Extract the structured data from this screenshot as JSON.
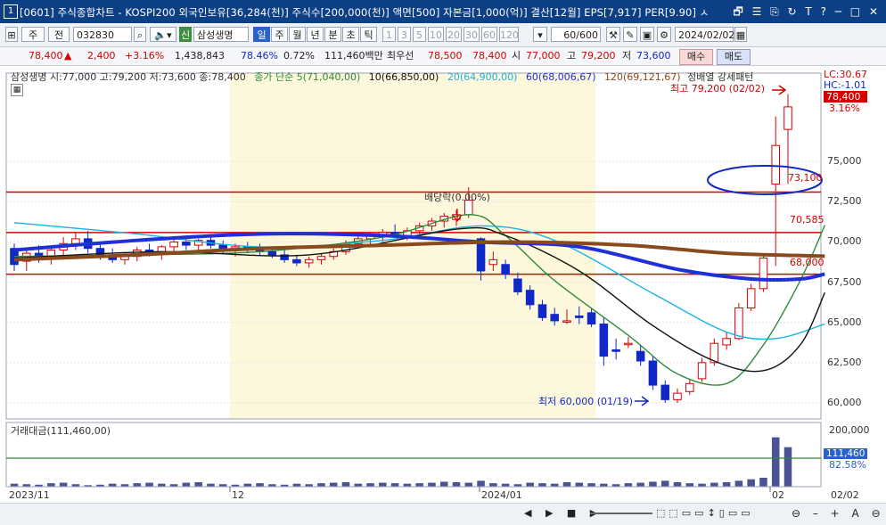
{
  "window": {
    "num": "1",
    "title": "[0601] 주식종합차트 - KOSPI200 외국인보유[36,284(천)] 주식수[200,000(천)] 액면[500] 자본금[1,000(억)] 결산[12월] EPS[7,917] PER[9.90] ㅅ",
    "icons": "🗗 ☰ ⎘ ↻ T ? ─ □ ✕"
  },
  "toolbar": {
    "market": "주",
    "period_btn": "전",
    "code": "032830",
    "badge": "신",
    "name": "삼성생명",
    "periods": [
      "일",
      "주",
      "월",
      "년",
      "분",
      "초",
      "틱"
    ],
    "minutes": [
      "1",
      "3",
      "5",
      "10",
      "20",
      "30",
      "60",
      "120"
    ],
    "count": "60",
    "total": "/600",
    "date": "2024/02/02",
    "buy": "매수",
    "sell": "매도"
  },
  "quote": {
    "price": "78,400",
    "arrow": "▲",
    "change": "2,400",
    "pct": "+3.16%",
    "volume": "1,438,843",
    "vol_ratio": "78.46%",
    "turnover": "0.72%",
    "amount": "111,460백만",
    "pref_label": "최우선",
    "ask": "78,500",
    "bid": "78,400",
    "open_label": "시",
    "open": "77,000",
    "high_label": "고",
    "high": "79,200",
    "low_label": "저",
    "low": "73,600"
  },
  "price_panel": {
    "legend_name": "삼성생명 시:77,000 고:79,200 저:73,600 종:78,400",
    "ma_label": "종가 단순 5(71,040,00)",
    "ma10": "10(66,850,00)",
    "ma20": "20(64,900,00)",
    "ma60": "60(68,006,67)",
    "ma120": "120(69,121,67)",
    "pattern": "정배열 강세패턴",
    "lc": "LC:30.67",
    "hc": "HC:-1.01",
    "last_price": "78,400",
    "last_pct": "3.16%",
    "high_note": "최고 79,200 (02/02)",
    "low_note": "최저 60,000 (01/19)",
    "dividend_note": "배당락(0.00%)",
    "level_73100": "73,100",
    "level_70585": "70,585",
    "level_68000": "68,000",
    "y_ticks": [
      "75,000",
      "72,500",
      "70,000",
      "67,500",
      "65,000",
      "62,500",
      "60,000"
    ]
  },
  "volume_panel": {
    "label": "거래대금(111,460,00)",
    "tick_top": "200,000",
    "current": "111,460",
    "current_pct": "82.58%"
  },
  "x_axis": {
    "labels": [
      "2023/11",
      "12",
      "2024/01",
      "02"
    ],
    "corner": "02/02"
  },
  "status": {
    "buttons": "◀ ▶ ■ ▶"
  },
  "colors": {
    "title_bg": "#0d3f84",
    "up": "#d60000",
    "down": "#1028c8",
    "ma5": "#2e8b3a",
    "ma10": "#111111",
    "ma20": "#19b3e6",
    "ma60": "#2030d8",
    "ma120": "#8a4a1e",
    "highlight": "#fdf8dc"
  },
  "chart_data": {
    "type": "candlestick",
    "title": "삼성생명",
    "ylim": [
      59000,
      80500
    ],
    "candles": [
      {
        "o": 69600,
        "h": 69900,
        "l": 68200,
        "c": 68600
      },
      {
        "o": 68800,
        "h": 69500,
        "l": 68200,
        "c": 69300
      },
      {
        "o": 69300,
        "h": 69800,
        "l": 68700,
        "c": 69100
      },
      {
        "o": 69100,
        "h": 69700,
        "l": 68600,
        "c": 69500
      },
      {
        "o": 69500,
        "h": 70300,
        "l": 69200,
        "c": 69900
      },
      {
        "o": 69900,
        "h": 70600,
        "l": 69500,
        "c": 70200
      },
      {
        "o": 70200,
        "h": 70700,
        "l": 69300,
        "c": 69600
      },
      {
        "o": 69600,
        "h": 69900,
        "l": 68900,
        "c": 69200
      },
      {
        "o": 69200,
        "h": 69600,
        "l": 68700,
        "c": 68900
      },
      {
        "o": 68900,
        "h": 69300,
        "l": 68600,
        "c": 69100
      },
      {
        "o": 69100,
        "h": 69700,
        "l": 68800,
        "c": 69500
      },
      {
        "o": 69500,
        "h": 69900,
        "l": 69100,
        "c": 69400
      },
      {
        "o": 69400,
        "h": 69800,
        "l": 68900,
        "c": 69700
      },
      {
        "o": 69700,
        "h": 70200,
        "l": 69400,
        "c": 70000
      },
      {
        "o": 70000,
        "h": 70400,
        "l": 69500,
        "c": 69800
      },
      {
        "o": 69800,
        "h": 70200,
        "l": 69300,
        "c": 70100
      },
      {
        "o": 70100,
        "h": 70500,
        "l": 69600,
        "c": 69800
      },
      {
        "o": 69800,
        "h": 70100,
        "l": 69300,
        "c": 69500
      },
      {
        "o": 69500,
        "h": 69900,
        "l": 69100,
        "c": 69700
      },
      {
        "o": 69700,
        "h": 70000,
        "l": 69300,
        "c": 69600
      },
      {
        "o": 69600,
        "h": 69900,
        "l": 69200,
        "c": 69400
      },
      {
        "o": 69400,
        "h": 69700,
        "l": 69000,
        "c": 69200
      },
      {
        "o": 69200,
        "h": 69500,
        "l": 68700,
        "c": 68900
      },
      {
        "o": 68900,
        "h": 69200,
        "l": 68500,
        "c": 68700
      },
      {
        "o": 68700,
        "h": 69100,
        "l": 68400,
        "c": 68900
      },
      {
        "o": 68900,
        "h": 69300,
        "l": 68600,
        "c": 69100
      },
      {
        "o": 69100,
        "h": 69600,
        "l": 68900,
        "c": 69400
      },
      {
        "o": 69400,
        "h": 70100,
        "l": 69200,
        "c": 69900
      },
      {
        "o": 69900,
        "h": 70400,
        "l": 69600,
        "c": 70200
      },
      {
        "o": 70200,
        "h": 70600,
        "l": 69800,
        "c": 70400
      },
      {
        "o": 70400,
        "h": 70800,
        "l": 70000,
        "c": 70600
      },
      {
        "o": 70600,
        "h": 71100,
        "l": 70300,
        "c": 70400
      },
      {
        "o": 70400,
        "h": 70900,
        "l": 70100,
        "c": 70700
      },
      {
        "o": 70700,
        "h": 71200,
        "l": 70400,
        "c": 71000
      },
      {
        "o": 71000,
        "h": 71500,
        "l": 70700,
        "c": 71300
      },
      {
        "o": 71300,
        "h": 71800,
        "l": 70900,
        "c": 71600
      },
      {
        "o": 71400,
        "h": 72000,
        "l": 71000,
        "c": 71700
      },
      {
        "o": 71700,
        "h": 73400,
        "l": 71500,
        "c": 72600
      },
      {
        "o": 70200,
        "h": 70300,
        "l": 67600,
        "c": 68200
      },
      {
        "o": 68600,
        "h": 69400,
        "l": 68200,
        "c": 68900
      },
      {
        "o": 68600,
        "h": 68900,
        "l": 67700,
        "c": 68000
      },
      {
        "o": 67700,
        "h": 68100,
        "l": 66700,
        "c": 66900
      },
      {
        "o": 67000,
        "h": 67300,
        "l": 65800,
        "c": 66100
      },
      {
        "o": 66100,
        "h": 66400,
        "l": 65100,
        "c": 65300
      },
      {
        "o": 65500,
        "h": 65900,
        "l": 64800,
        "c": 65100
      },
      {
        "o": 65100,
        "h": 65800,
        "l": 64900,
        "c": 65100
      },
      {
        "o": 65400,
        "h": 66000,
        "l": 64900,
        "c": 65300
      },
      {
        "o": 65600,
        "h": 65900,
        "l": 64700,
        "c": 64900
      },
      {
        "o": 64900,
        "h": 65300,
        "l": 62300,
        "c": 62900
      },
      {
        "o": 63300,
        "h": 64000,
        "l": 62700,
        "c": 63200
      },
      {
        "o": 63700,
        "h": 64100,
        "l": 63400,
        "c": 63700
      },
      {
        "o": 63200,
        "h": 63600,
        "l": 62300,
        "c": 62600
      },
      {
        "o": 62600,
        "h": 62900,
        "l": 60800,
        "c": 61100
      },
      {
        "o": 61100,
        "h": 61400,
        "l": 60000,
        "c": 60200
      },
      {
        "o": 60200,
        "h": 60900,
        "l": 60000,
        "c": 60600
      },
      {
        "o": 60700,
        "h": 61500,
        "l": 60500,
        "c": 61200
      },
      {
        "o": 61500,
        "h": 62800,
        "l": 61300,
        "c": 62500
      },
      {
        "o": 62500,
        "h": 64000,
        "l": 62300,
        "c": 63700
      },
      {
        "o": 63600,
        "h": 64400,
        "l": 63300,
        "c": 64000
      },
      {
        "o": 64000,
        "h": 66200,
        "l": 63900,
        "c": 65900
      },
      {
        "o": 65900,
        "h": 67400,
        "l": 65700,
        "c": 67100
      },
      {
        "o": 67100,
        "h": 69200,
        "l": 66900,
        "c": 69000
      },
      {
        "o": 73600,
        "h": 77800,
        "l": 68500,
        "c": 76000
      },
      {
        "o": 77000,
        "h": 79200,
        "l": 73600,
        "c": 78400
      }
    ],
    "ma5": [
      [
        0,
        69100
      ],
      [
        10,
        69200
      ],
      [
        20,
        69400
      ],
      [
        30,
        70300
      ],
      [
        37,
        71700
      ],
      [
        40,
        70400
      ],
      [
        44,
        67600
      ],
      [
        50,
        64200
      ],
      [
        54,
        61800
      ],
      [
        58,
        61200
      ],
      [
        61,
        63600
      ],
      [
        64,
        67600
      ],
      [
        66,
        71040
      ]
    ],
    "ma10": [
      [
        0,
        69000
      ],
      [
        12,
        69400
      ],
      [
        24,
        69200
      ],
      [
        36,
        70800
      ],
      [
        40,
        70400
      ],
      [
        46,
        68200
      ],
      [
        52,
        64800
      ],
      [
        57,
        62600
      ],
      [
        61,
        62000
      ],
      [
        64,
        63600
      ],
      [
        66,
        66850
      ]
    ],
    "ma20": [
      [
        0,
        71200
      ],
      [
        10,
        70500
      ],
      [
        20,
        69700
      ],
      [
        30,
        70100
      ],
      [
        38,
        71000
      ],
      [
        44,
        70100
      ],
      [
        52,
        66800
      ],
      [
        58,
        64400
      ],
      [
        62,
        64000
      ],
      [
        66,
        64900
      ]
    ],
    "ma60": [
      [
        0,
        69500
      ],
      [
        10,
        70100
      ],
      [
        20,
        70500
      ],
      [
        30,
        70400
      ],
      [
        38,
        70000
      ],
      [
        46,
        69700
      ],
      [
        54,
        68300
      ],
      [
        60,
        67700
      ],
      [
        64,
        67700
      ],
      [
        66,
        68006
      ]
    ],
    "ma120": [
      [
        0,
        68900
      ],
      [
        10,
        69200
      ],
      [
        20,
        69600
      ],
      [
        30,
        69800
      ],
      [
        40,
        70000
      ],
      [
        50,
        69800
      ],
      [
        58,
        69300
      ],
      [
        66,
        69121
      ]
    ],
    "volume": [
      6,
      5,
      4,
      7,
      8,
      5,
      3,
      4,
      6,
      5,
      7,
      8,
      6,
      5,
      8,
      9,
      6,
      5,
      4,
      6,
      7,
      5,
      4,
      6,
      5,
      7,
      8,
      9,
      6,
      7,
      8,
      7,
      6,
      7,
      8,
      10,
      9,
      8,
      12,
      7,
      6,
      5,
      8,
      7,
      6,
      9,
      8,
      7,
      6,
      5,
      7,
      8,
      10,
      12,
      9,
      7,
      6,
      8,
      9,
      12,
      15,
      18,
      100,
      80
    ],
    "vol_max": 200000
  }
}
